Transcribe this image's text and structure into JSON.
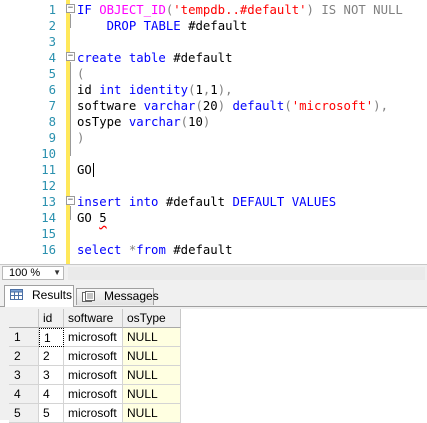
{
  "editor": {
    "lines": [
      {
        "n": "1",
        "html": "<span class=\"kw\">IF</span> <span class=\"fn\">OBJECT_ID</span><span class=\"gr\">(</span><span class=\"str\">'tempdb..#default'</span><span class=\"gr\">)</span> <span class=\"gr\">IS NOT NULL</span>"
      },
      {
        "n": "2",
        "html": "    <span class=\"kw\">DROP TABLE</span> #default"
      },
      {
        "n": "3",
        "html": ""
      },
      {
        "n": "4",
        "html": "<span class=\"kw\">create table</span> #default"
      },
      {
        "n": "5",
        "html": "<span class=\"gr\">(</span>"
      },
      {
        "n": "6",
        "html": "id <span class=\"kw\">int</span> <span class=\"kw\">identity</span><span class=\"gr\">(</span>1<span class=\"gr\">,</span>1<span class=\"gr\">),</span>"
      },
      {
        "n": "7",
        "html": "software <span class=\"kw\">varchar</span><span class=\"gr\">(</span>20<span class=\"gr\">)</span> <span class=\"kw\">default</span><span class=\"gr\">(</span><span class=\"str\">'microsoft'</span><span class=\"gr\">),</span>"
      },
      {
        "n": "8",
        "html": "osType <span class=\"kw\">varchar</span><span class=\"gr\">(</span>10<span class=\"gr\">)</span>"
      },
      {
        "n": "9",
        "html": "<span class=\"gr\">)</span>"
      },
      {
        "n": "10",
        "html": ""
      },
      {
        "n": "11",
        "html": "GO"
      },
      {
        "n": "12",
        "html": ""
      },
      {
        "n": "13",
        "html": "<span class=\"kw\">insert into</span> #default <span class=\"kw\">DEFAULT VALUES</span>"
      },
      {
        "n": "14",
        "html": "GO <span class=\"squiggle\">5</span>"
      },
      {
        "n": "15",
        "html": ""
      },
      {
        "n": "16",
        "html": "<span class=\"kw\">select</span> <span class=\"gr\">*</span><span class=\"kw\">from</span> #default"
      }
    ]
  },
  "zoom": {
    "value": "100 %"
  },
  "tabs": {
    "results": "Results",
    "messages": "Messages"
  },
  "grid": {
    "columns": [
      "id",
      "software",
      "osType"
    ],
    "rows": [
      {
        "num": "1",
        "id": "1",
        "software": "microsoft",
        "osType": "NULL"
      },
      {
        "num": "2",
        "id": "2",
        "software": "microsoft",
        "osType": "NULL"
      },
      {
        "num": "3",
        "id": "3",
        "software": "microsoft",
        "osType": "NULL"
      },
      {
        "num": "4",
        "id": "4",
        "software": "microsoft",
        "osType": "NULL"
      },
      {
        "num": "5",
        "id": "5",
        "software": "microsoft",
        "osType": "NULL"
      }
    ]
  }
}
